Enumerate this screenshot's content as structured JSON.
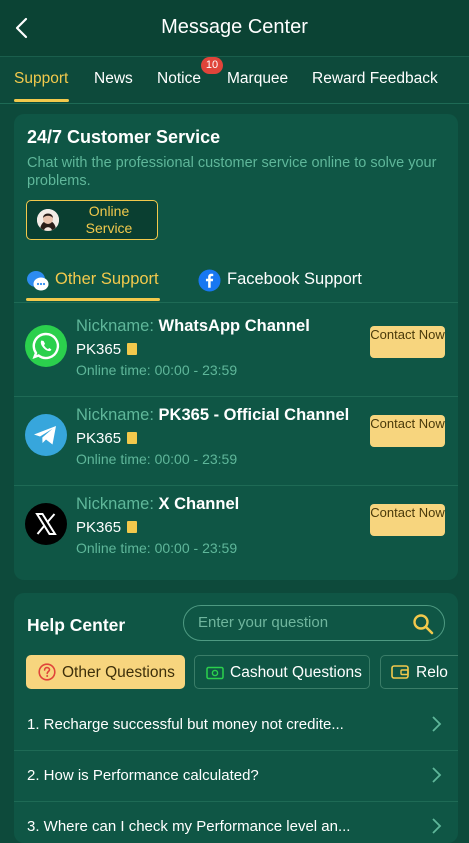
{
  "header": {
    "title": "Message Center"
  },
  "tabs": [
    {
      "label": "Support"
    },
    {
      "label": "News"
    },
    {
      "label": "Notice",
      "badge": "10"
    },
    {
      "label": "Marquee"
    },
    {
      "label": "Reward Feedback"
    }
  ],
  "customer_service": {
    "title": "24/7 Customer Service",
    "description": "Chat with the professional customer service online to solve your problems.",
    "online_button": "Online Service"
  },
  "support_tabs": [
    {
      "label": "Other Support"
    },
    {
      "label": "Facebook Support"
    }
  ],
  "channels": [
    {
      "nickname_label": "Nickname:",
      "nickname": "WhatsApp Channel",
      "account": "PK365",
      "time_label": "Online time:",
      "time": "00:00 - 23:59",
      "contact": "Contact Now",
      "icon": "whatsapp-icon"
    },
    {
      "nickname_label": "Nickname:",
      "nickname": "PK365 - Official Channel",
      "account": "PK365",
      "time_label": "Online time:",
      "time": "00:00 - 23:59",
      "contact": "Contact Now",
      "icon": "telegram-icon"
    },
    {
      "nickname_label": "Nickname:",
      "nickname": "X Channel",
      "account": "PK365",
      "time_label": "Online time:",
      "time": "00:00 - 23:59",
      "contact": "Contact Now",
      "icon": "x-icon"
    }
  ],
  "help_center": {
    "title": "Help Center",
    "search_placeholder": "Enter your question",
    "question_tabs": [
      {
        "label": "Other Questions"
      },
      {
        "label": "Cashout Questions"
      },
      {
        "label": "Relo"
      }
    ],
    "questions": [
      "1. Recharge successful but money not credite...",
      "2. How is Performance calculated?",
      "3. Where can I check my Performance level an..."
    ]
  },
  "colors": {
    "accent": "#f2c94c",
    "background": "#0d4a3b",
    "card": "#0f5645",
    "muted_text": "#5fb79a",
    "badge": "#e0443a"
  }
}
